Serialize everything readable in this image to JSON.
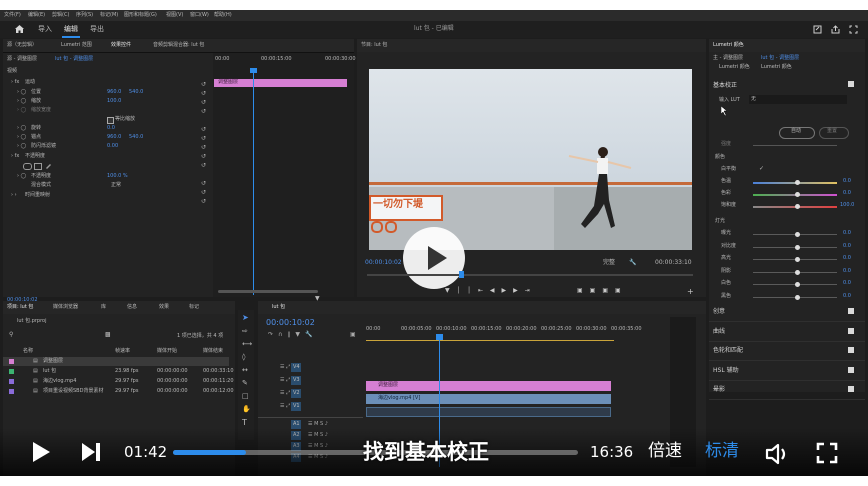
{
  "colors": {
    "accent_blue": "#2d8ceb",
    "timecode_blue": "#4f8fe8",
    "clip_pink": "#d67fd3",
    "clip_blue": "#6b8fb8",
    "label_green": "#3cb371",
    "label_purple": "#8a6bd9"
  },
  "menubar": {
    "items": [
      "文件(F)",
      "编辑(E)",
      "剪辑(C)",
      "序列(S)",
      "标记(M)",
      "图形和标题(G)",
      "视图(V)",
      "窗口(W)",
      "帮助(H)"
    ]
  },
  "workspace": {
    "tabs": [
      "导入",
      "编辑",
      "导出"
    ],
    "active_tab": "编辑",
    "project_title": "lut 包 - 已编辑"
  },
  "effect_controls": {
    "tabs": [
      "源（无剪辑）",
      "Lumetri 范围",
      "效果控件",
      "音频剪辑混合器: lut 包"
    ],
    "source_label": "源 - 调整图层",
    "sequence_label": "lut 包 - 调整图层",
    "sections": {
      "video": "视频",
      "motion": "运动",
      "opacity": "不透明度",
      "time_remap": "时间重映射"
    },
    "properties": [
      {
        "name": "位置",
        "value": "960.0",
        "value2": "540.0"
      },
      {
        "name": "缩放",
        "value": "100.0",
        "value2": ""
      },
      {
        "name": "缩放宽度",
        "value": "",
        "value2": ""
      },
      {
        "name": "旋转",
        "value": "0.0",
        "value2": ""
      },
      {
        "name": "锚点",
        "value": "960.0",
        "value2": "540.0"
      },
      {
        "name": "防闪烁滤镜",
        "value": "0.00",
        "value2": ""
      }
    ],
    "uniform_scale": "等比缩放",
    "opacity_value": "100.0 %",
    "blend_mode_label": "混合模式",
    "blend_mode_value": "正常",
    "timecode": "00:00:10:02",
    "ruler": [
      "00:00",
      "00:00:15:00",
      "00:00:30:00"
    ],
    "clip_label": "调整图层"
  },
  "program_monitor": {
    "title": "节目: lut 包",
    "timecode_left": "00:00:10:02",
    "timecode_right": "00:00:33:10",
    "fit_label": "完整",
    "overlay_text": "一切勿下堤"
  },
  "lumetri": {
    "tab": "Lumetri 颜色",
    "header_left": "主 - 调整图层",
    "header_right": "lut 包 - 调整图层",
    "fx_label": "Lumetri 颜色",
    "basic_section": "基本校正",
    "input_lut_label": "输入 LUT",
    "input_lut_value": "无",
    "auto_button": "自动",
    "reset_button": "重置",
    "intensity_label": "强度",
    "color_section": "颜色",
    "white_balance": "白平衡",
    "light_section": "灯光",
    "color_sliders": [
      {
        "name": "色温",
        "value": "0.0"
      },
      {
        "name": "色彩",
        "value": "0.0"
      },
      {
        "name": "饱和度",
        "value": "100.0"
      }
    ],
    "light_sliders": [
      {
        "name": "曝光",
        "value": "0.0"
      },
      {
        "name": "对比度",
        "value": "0.0"
      },
      {
        "name": "高光",
        "value": "0.0"
      },
      {
        "name": "阴影",
        "value": "0.0"
      },
      {
        "name": "白色",
        "value": "0.0"
      },
      {
        "name": "黑色",
        "value": "0.0"
      }
    ],
    "sections": [
      "创意",
      "曲线",
      "色轮和匹配",
      "HSL 辅助",
      "晕影"
    ]
  },
  "project_panel": {
    "tabs": [
      "项目: lut 包",
      "媒体浏览器",
      "库",
      "信息",
      "效果",
      "标记"
    ],
    "file_name": "lut 包.prproj",
    "selection_info": "1 项已选择，共 4 项",
    "columns": [
      "名称",
      "帧速率",
      "媒体开始",
      "媒体结束"
    ],
    "rows": [
      {
        "name": "调整图层",
        "fps": "",
        "start": "",
        "end": ""
      },
      {
        "name": "lut 包",
        "fps": "23.98 fps",
        "start": "00:00:00:00",
        "end": "00:00:33:10"
      },
      {
        "name": "海边vlog.mp4",
        "fps": "29.97 fps",
        "start": "00:00:00:00",
        "end": "00:00:11:20"
      },
      {
        "name": "项目重设视频SBD背景素材",
        "fps": "29.97 fps",
        "start": "00:00:00:00",
        "end": "00:00:12:00"
      }
    ]
  },
  "timeline": {
    "title": "lut 包",
    "timecode": "00:00:10:02",
    "ruler": [
      "00:00",
      "00:00:05:00",
      "00:00:10:00",
      "00:00:15:00",
      "00:00:20:00",
      "00:00:25:00",
      "00:00:30:00",
      "00:00:35:00"
    ],
    "video_tracks": [
      "V4",
      "V3",
      "V2",
      "V1"
    ],
    "audio_tracks": [
      "A1",
      "A2",
      "A3",
      "A4"
    ],
    "clips": [
      {
        "label": "调整图层",
        "track": "V2"
      },
      {
        "label": "海边vlog.mp4 [V]",
        "track": "V1"
      }
    ]
  },
  "player": {
    "current_time": "01:42",
    "total_time": "16:36",
    "progress": 0.18,
    "subtitle": "找到基本校正",
    "speed_label": "倍速",
    "quality_label": "标清"
  }
}
